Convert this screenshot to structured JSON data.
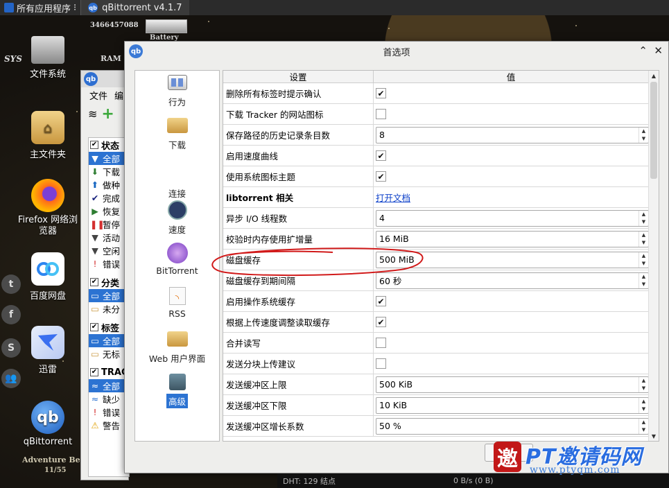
{
  "colors": {
    "accent": "#2c73d2",
    "link": "#0b3fc9",
    "annotation": "#d11a1a"
  },
  "top_panel": {
    "apps_label": "所有应用程序",
    "task_title": "qBittorrent v4.1.7"
  },
  "hud": {
    "id_number": "3466457088",
    "ram": "RAM",
    "battery": "Battery",
    "sys": "SYS",
    "footer": "Adventure Begi",
    "footer_date": "11/55"
  },
  "desktop_icons": [
    {
      "label": "文件系统",
      "icon": "drive-icon"
    },
    {
      "label": "主文件夹",
      "icon": "home-folder-icon"
    },
    {
      "label": "Firefox 网络浏览器",
      "icon": "firefox-icon"
    },
    {
      "label": "百度网盘",
      "icon": "baidu-netdisk-icon"
    },
    {
      "label": "迅雷",
      "icon": "xunlei-icon"
    },
    {
      "label": "qBittorrent",
      "icon": "qbittorrent-icon"
    }
  ],
  "main_window": {
    "menu_file": "文件",
    "menu_edit": "编",
    "sections": [
      {
        "head": "状态",
        "items": [
          "全部",
          "下载",
          "做种",
          "完成",
          "恢复",
          "暂停",
          "活动",
          "空闲",
          "错误"
        ]
      },
      {
        "head": "分类",
        "items": [
          "全部",
          "未分"
        ]
      },
      {
        "head": "标签",
        "items": [
          "全部",
          "无标"
        ]
      },
      {
        "head": "TRAC",
        "items": [
          "全部",
          "缺少",
          "错误",
          "警告"
        ]
      }
    ]
  },
  "prefs": {
    "title": "首选项",
    "col_setting": "设置",
    "col_value": "值",
    "categories": [
      {
        "label": "行为",
        "icon": "behavior-icon"
      },
      {
        "label": "下载",
        "icon": "downloads-folder-icon"
      },
      {
        "label": "连接",
        "icon": "connection-icon"
      },
      {
        "label": "速度",
        "icon": "speed-gauge-icon"
      },
      {
        "label": "BitTorrent",
        "icon": "bittorrent-icon"
      },
      {
        "label": "RSS",
        "icon": "rss-icon"
      },
      {
        "label": "Web 用户界面",
        "icon": "web-ui-icon"
      },
      {
        "label": "高级",
        "icon": "advanced-tools-icon"
      }
    ],
    "rows": [
      {
        "key": "删除所有标签时提示确认",
        "type": "check",
        "checked": true
      },
      {
        "key": "下载 Tracker 的网站图标",
        "type": "check",
        "checked": false
      },
      {
        "key": "保存路径的历史记录条目数",
        "type": "spin",
        "value": "8"
      },
      {
        "key": "启用速度曲线",
        "type": "check",
        "checked": true
      },
      {
        "key": "使用系统图标主题",
        "type": "check",
        "checked": true
      },
      {
        "key": "libtorrent 相关",
        "type": "link",
        "value": "打开文档",
        "bold": true
      },
      {
        "key": "异步 I/O 线程数",
        "type": "spin",
        "value": "4"
      },
      {
        "key": "校验时内存使用扩增量",
        "type": "spin",
        "value": "16 MiB"
      },
      {
        "key": "磁盘缓存",
        "type": "spin",
        "value": "500 MiB"
      },
      {
        "key": "磁盘缓存到期间隔",
        "type": "spin",
        "value": "60 秒"
      },
      {
        "key": "启用操作系统缓存",
        "type": "check",
        "checked": true
      },
      {
        "key": "根据上传速度调整读取缓存",
        "type": "check",
        "checked": true
      },
      {
        "key": "合并读写",
        "type": "check",
        "checked": false
      },
      {
        "key": "发送分块上传建议",
        "type": "check",
        "checked": false
      },
      {
        "key": "发送缓冲区上限",
        "type": "spin",
        "value": "500 KiB"
      },
      {
        "key": "发送缓冲区下限",
        "type": "spin",
        "value": "10 KiB"
      },
      {
        "key": "发送缓冲区增长系数",
        "type": "spin",
        "value": "50 %"
      }
    ]
  },
  "status_bar": {
    "dht": "DHT: 129 结点",
    "speed_down": "0 B/s (0 B)"
  },
  "watermark": {
    "seal": "邀",
    "brand": "PT邀请码网",
    "url": "www.ptyqm.com"
  }
}
